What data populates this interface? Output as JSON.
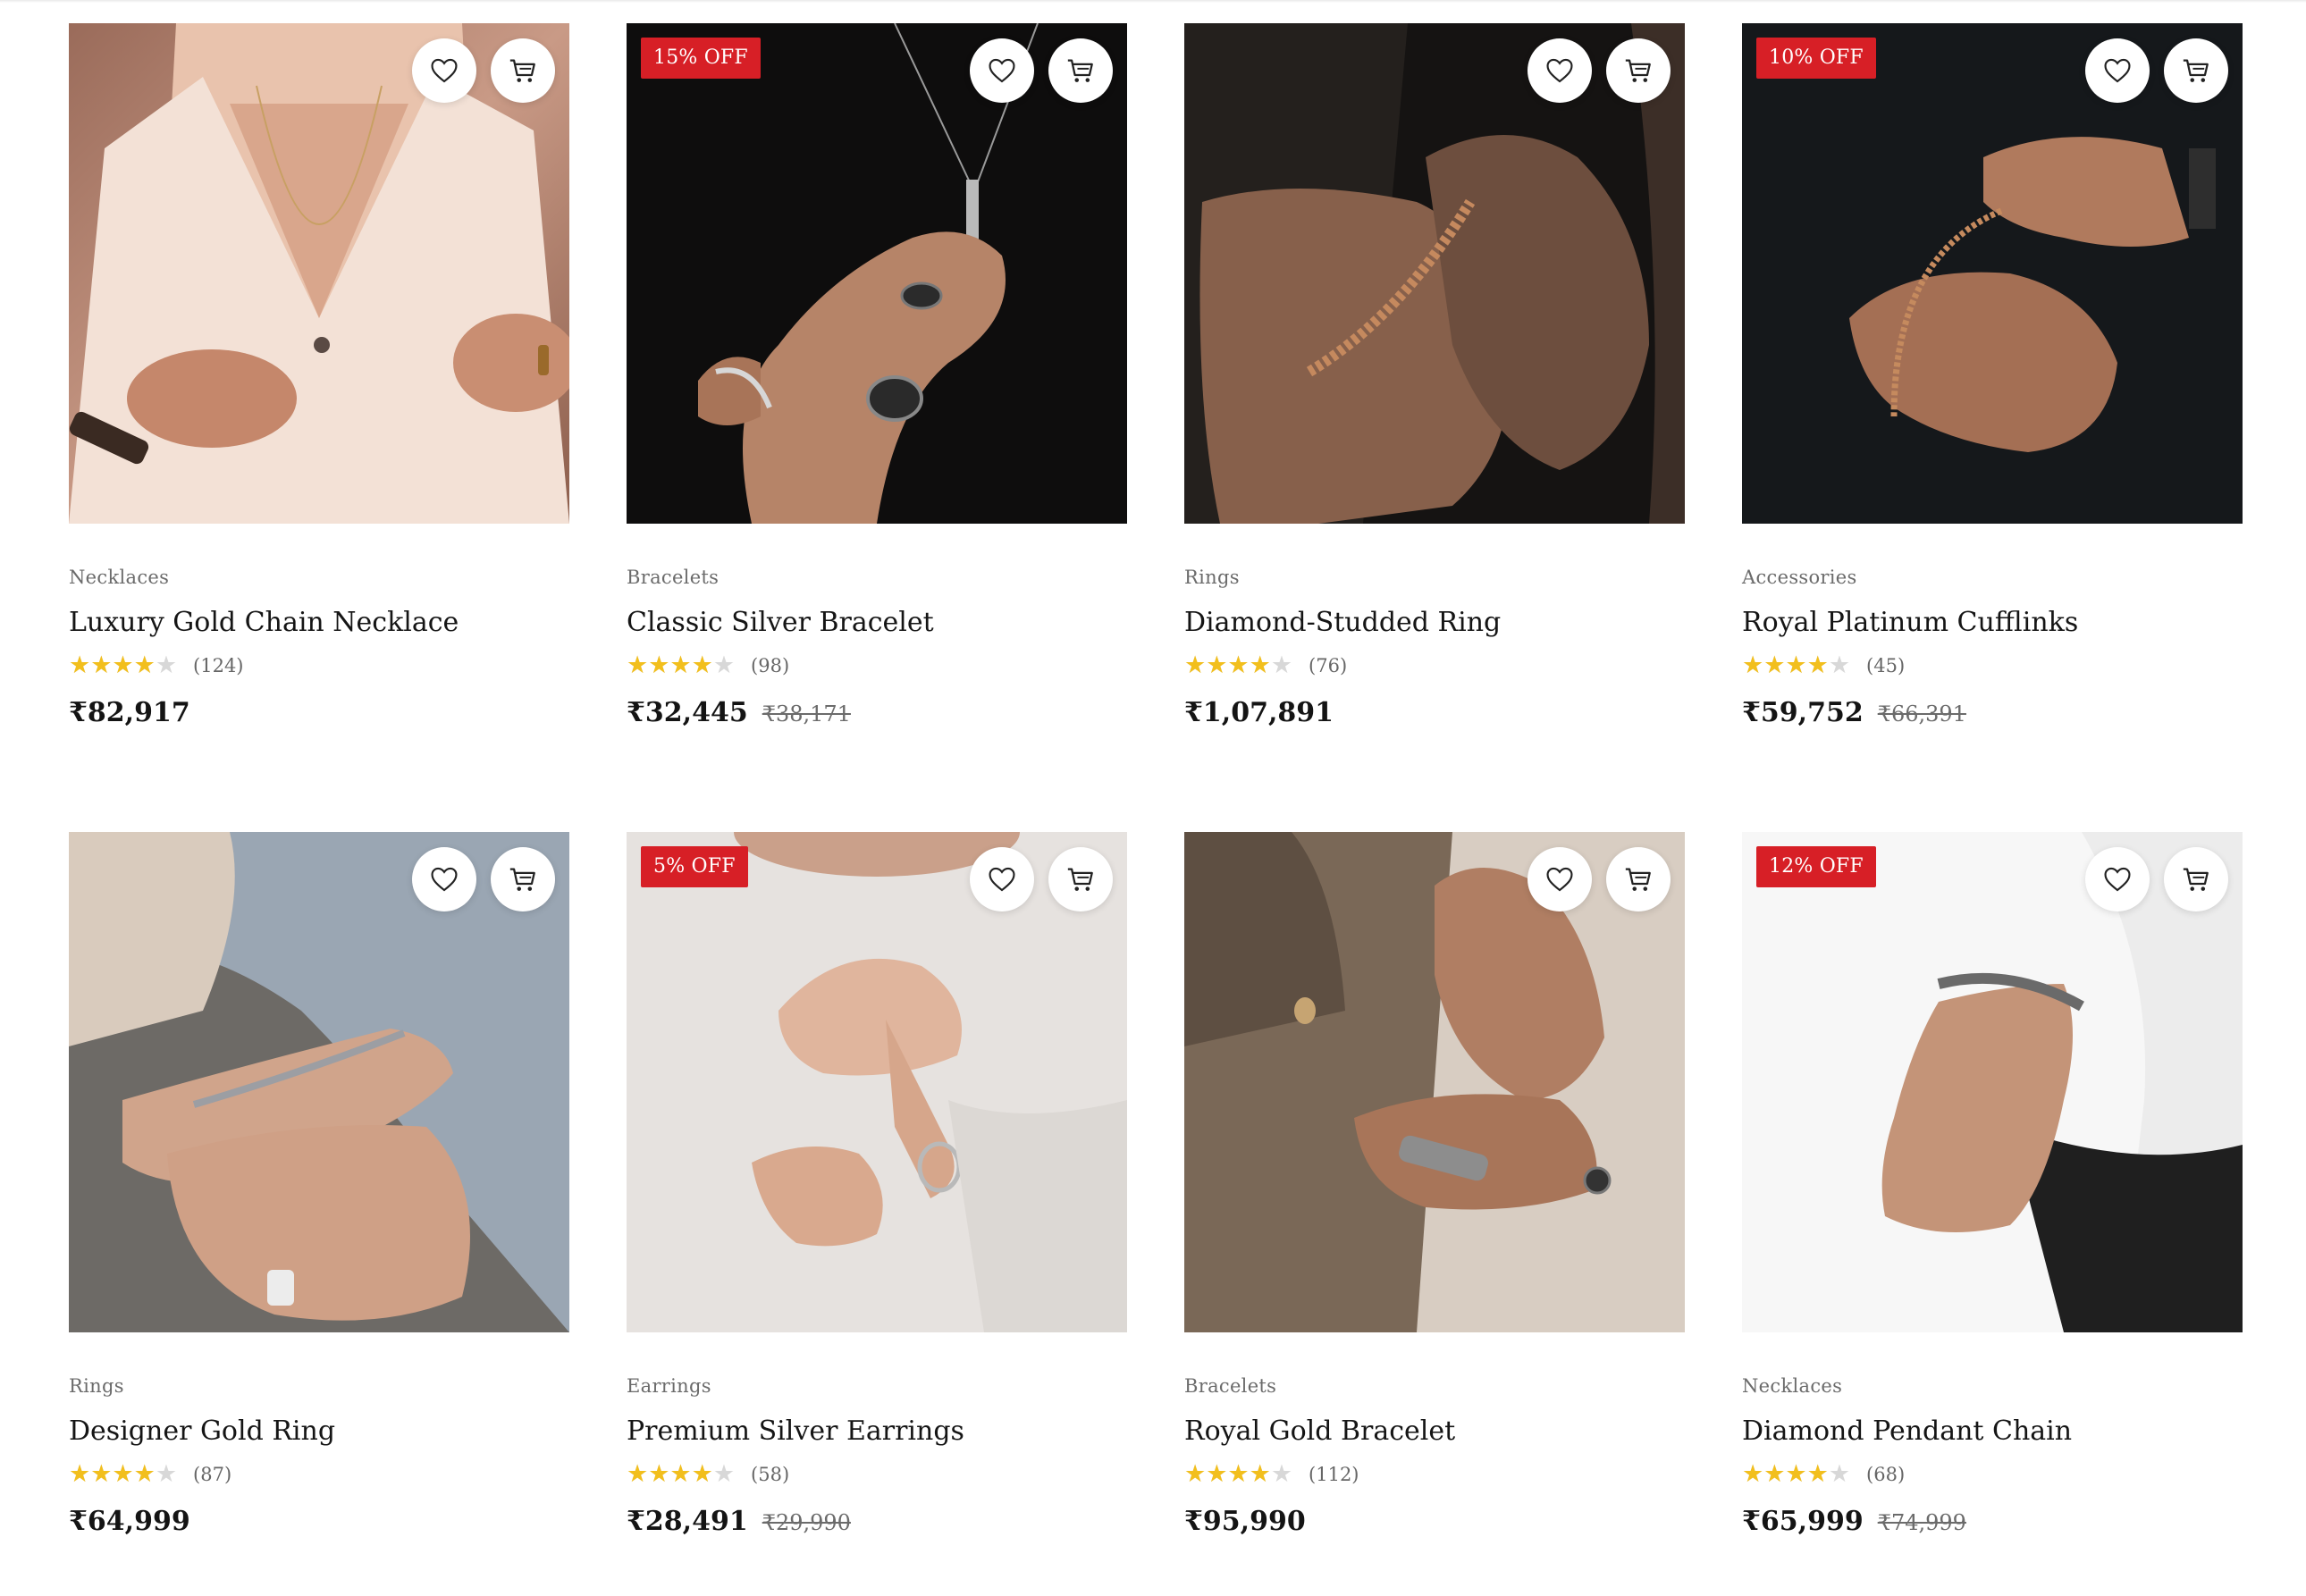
{
  "colors": {
    "badge": "#d71f26",
    "star": "#f2bf1d",
    "star_empty": "#d8d8d8"
  },
  "icons": {
    "wishlist": "heart-icon",
    "cart": "cart-icon",
    "star": "star-icon"
  },
  "products": [
    {
      "category": "Necklaces",
      "name": "Luxury Gold Chain Necklace",
      "rating": 4,
      "reviews": "(124)",
      "price": "₹82,917",
      "old_price": "",
      "badge": ""
    },
    {
      "category": "Bracelets",
      "name": "Classic Silver Bracelet",
      "rating": 4,
      "reviews": "(98)",
      "price": "₹32,445",
      "old_price": "₹38,171",
      "badge": "15% OFF"
    },
    {
      "category": "Rings",
      "name": "Diamond-Studded Ring",
      "rating": 4,
      "reviews": "(76)",
      "price": "₹1,07,891",
      "old_price": "",
      "badge": ""
    },
    {
      "category": "Accessories",
      "name": "Royal Platinum Cufflinks",
      "rating": 4,
      "reviews": "(45)",
      "price": "₹59,752",
      "old_price": "₹66,391",
      "badge": "10% OFF"
    },
    {
      "category": "Rings",
      "name": "Designer Gold Ring",
      "rating": 4,
      "reviews": "(87)",
      "price": "₹64,999",
      "old_price": "",
      "badge": ""
    },
    {
      "category": "Earrings",
      "name": "Premium Silver Earrings",
      "rating": 4,
      "reviews": "(58)",
      "price": "₹28,491",
      "old_price": "₹29,990",
      "badge": "5% OFF"
    },
    {
      "category": "Bracelets",
      "name": "Royal Gold Bracelet",
      "rating": 4,
      "reviews": "(112)",
      "price": "₹95,990",
      "old_price": "",
      "badge": ""
    },
    {
      "category": "Necklaces",
      "name": "Diamond Pendant Chain",
      "rating": 4,
      "reviews": "(68)",
      "price": "₹65,999",
      "old_price": "₹74,999",
      "badge": "12% OFF"
    }
  ]
}
